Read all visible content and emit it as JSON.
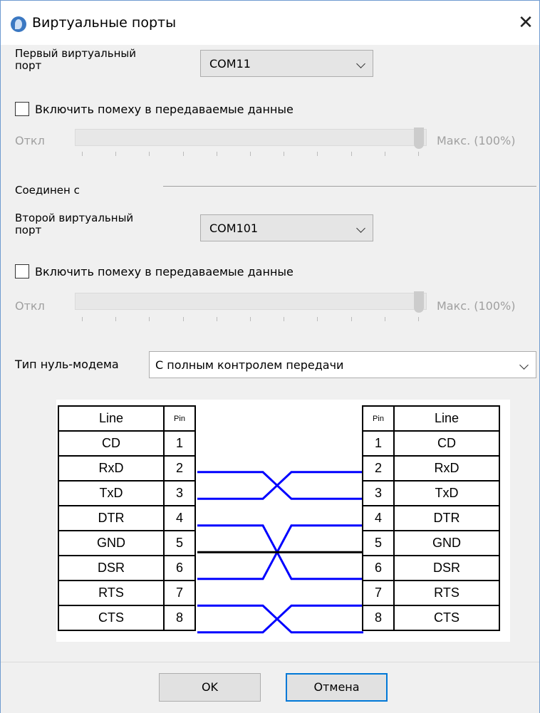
{
  "window": {
    "title": "Виртуальные порты"
  },
  "port1": {
    "label_line1": "Первый виртуальный",
    "label_line2": "порт",
    "value": "COM11",
    "noise_label": "Включить помеху в передаваемые данные",
    "noise_checked": false,
    "slider_min": "Откл",
    "slider_max": "Макс. (100%)",
    "slider_level_percent": 100
  },
  "connected_label": "Соединен с",
  "port2": {
    "label_line1": "Второй виртуальный",
    "label_line2": "порт",
    "value": "COM101",
    "noise_label": "Включить помеху в передаваемые данные",
    "noise_checked": false,
    "slider_min": "Откл",
    "slider_max": "Макс. (100%)",
    "slider_level_percent": 100
  },
  "modem": {
    "label": "Тип нуль-модема",
    "value": "С полным контролем передачи"
  },
  "diagram": {
    "header_line": "Line",
    "header_pin": "Pin",
    "left": [
      {
        "line": "CD",
        "pin": "1"
      },
      {
        "line": "RxD",
        "pin": "2"
      },
      {
        "line": "TxD",
        "pin": "3"
      },
      {
        "line": "DTR",
        "pin": "4"
      },
      {
        "line": "GND",
        "pin": "5"
      },
      {
        "line": "DSR",
        "pin": "6"
      },
      {
        "line": "RTS",
        "pin": "7"
      },
      {
        "line": "CTS",
        "pin": "8"
      }
    ],
    "right": [
      {
        "line": "CD",
        "pin": "1"
      },
      {
        "line": "RxD",
        "pin": "2"
      },
      {
        "line": "TxD",
        "pin": "3"
      },
      {
        "line": "DTR",
        "pin": "4"
      },
      {
        "line": "GND",
        "pin": "5"
      },
      {
        "line": "DSR",
        "pin": "6"
      },
      {
        "line": "RTS",
        "pin": "7"
      },
      {
        "line": "CTS",
        "pin": "8"
      }
    ],
    "wire_color": "#0000ff",
    "ground_color": "#000000"
  },
  "buttons": {
    "ok": "OK",
    "cancel": "Отмена"
  },
  "colors": {
    "accent": "#0078d7"
  }
}
